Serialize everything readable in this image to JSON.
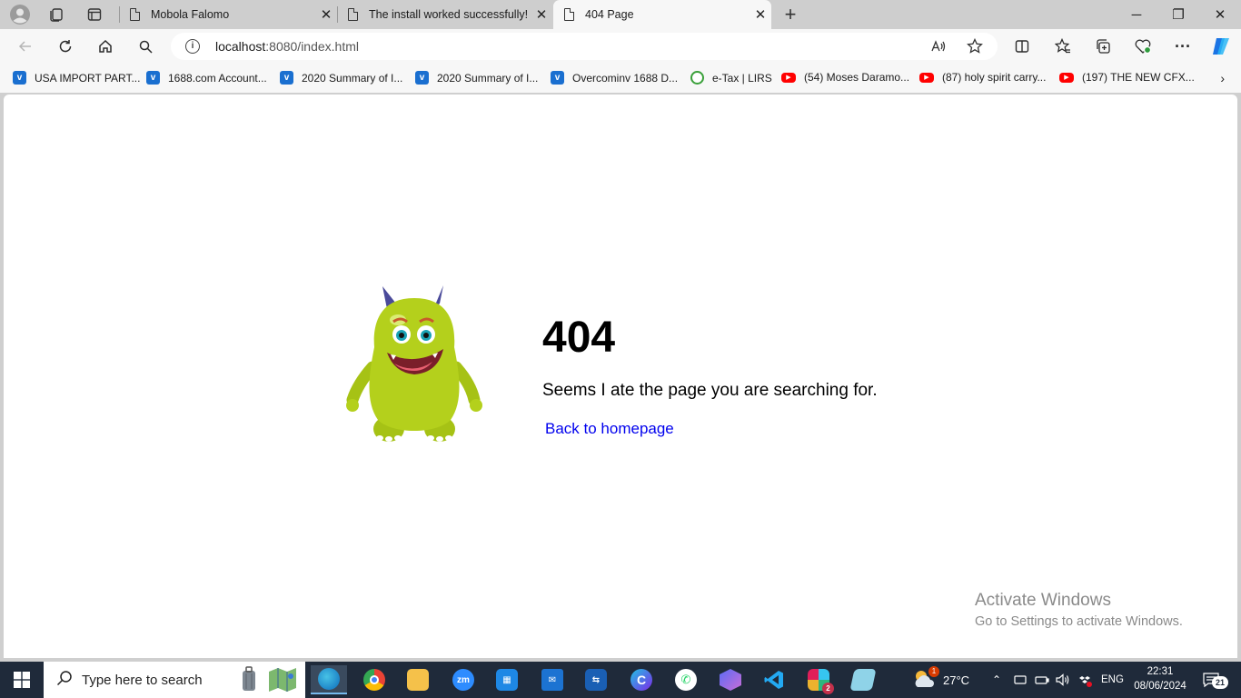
{
  "browser": {
    "tabs": [
      {
        "title": "Mobola Falomo",
        "close": "✕"
      },
      {
        "title": "The install worked successfully! C",
        "close": "✕"
      },
      {
        "title": "404 Page",
        "close": "✕"
      }
    ],
    "new_tab": "+",
    "window": {
      "minimize": "─",
      "restore": "❐",
      "close": "✕"
    },
    "address": {
      "host": "localhost",
      "rest": ":8080/index.html",
      "info": "i"
    },
    "menu": "···",
    "bookmarks": [
      {
        "label": "USA IMPORT PART...",
        "icon": "v"
      },
      {
        "label": "1688.com Account...",
        "icon": "v"
      },
      {
        "label": "2020 Summary of I...",
        "icon": "v"
      },
      {
        "label": "2020 Summary of I...",
        "icon": "v"
      },
      {
        "label": "Overcominv 1688 D...",
        "icon": "v"
      },
      {
        "label": "e-Tax | LIRS",
        "icon": "lirs"
      },
      {
        "label": "(54) Moses Daramo...",
        "icon": "youtube"
      },
      {
        "label": "(87) holy spirit carry...",
        "icon": "youtube"
      },
      {
        "label": "(197) THE NEW CFX...",
        "icon": "youtube"
      }
    ],
    "bookmarks_more": "›"
  },
  "page": {
    "code": "404",
    "message": "Seems I ate the page you are searching for.",
    "link": "Back to homepage"
  },
  "watermark": {
    "line1": "Activate Windows",
    "line2": "Go to Settings to activate Windows."
  },
  "taskbar": {
    "search_placeholder": "Type here to search",
    "weather": "27°C",
    "language": "ENG",
    "time": "22:31",
    "date": "08/06/2024",
    "notifications": "21",
    "slack_badge": "2",
    "weather_badge": "1"
  },
  "colors": {
    "link": "#0000ee",
    "taskbar": "#1f2a3a",
    "monster_body": "#b4d01c"
  }
}
